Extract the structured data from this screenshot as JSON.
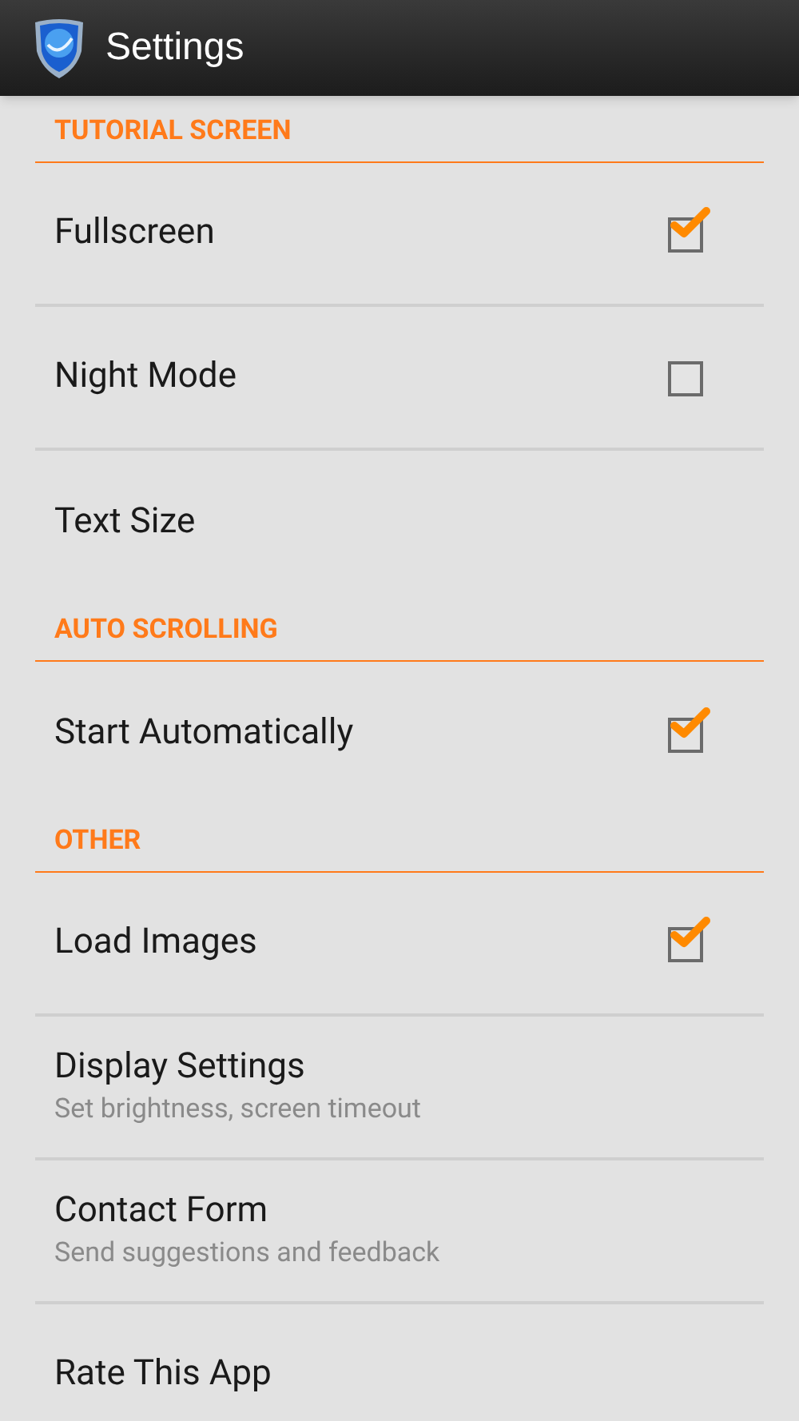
{
  "app_bar": {
    "title": "Settings"
  },
  "sections": [
    {
      "title": "TUTORIAL SCREEN",
      "items": [
        {
          "kind": "checkbox",
          "title": "Fullscreen",
          "checked": true
        },
        {
          "kind": "checkbox",
          "title": "Night Mode",
          "checked": false
        },
        {
          "kind": "plain",
          "title": "Text Size"
        }
      ]
    },
    {
      "title": "AUTO SCROLLING",
      "items": [
        {
          "kind": "checkbox",
          "title": "Start Automatically",
          "checked": true
        }
      ]
    },
    {
      "title": "OTHER",
      "items": [
        {
          "kind": "checkbox",
          "title": "Load Images",
          "checked": true
        },
        {
          "kind": "plain",
          "title": "Display Settings",
          "summary": "Set brightness, screen timeout"
        },
        {
          "kind": "plain",
          "title": "Contact Form",
          "summary": "Send suggestions and feedback"
        },
        {
          "kind": "plain",
          "title": "Rate This App"
        }
      ]
    }
  ]
}
